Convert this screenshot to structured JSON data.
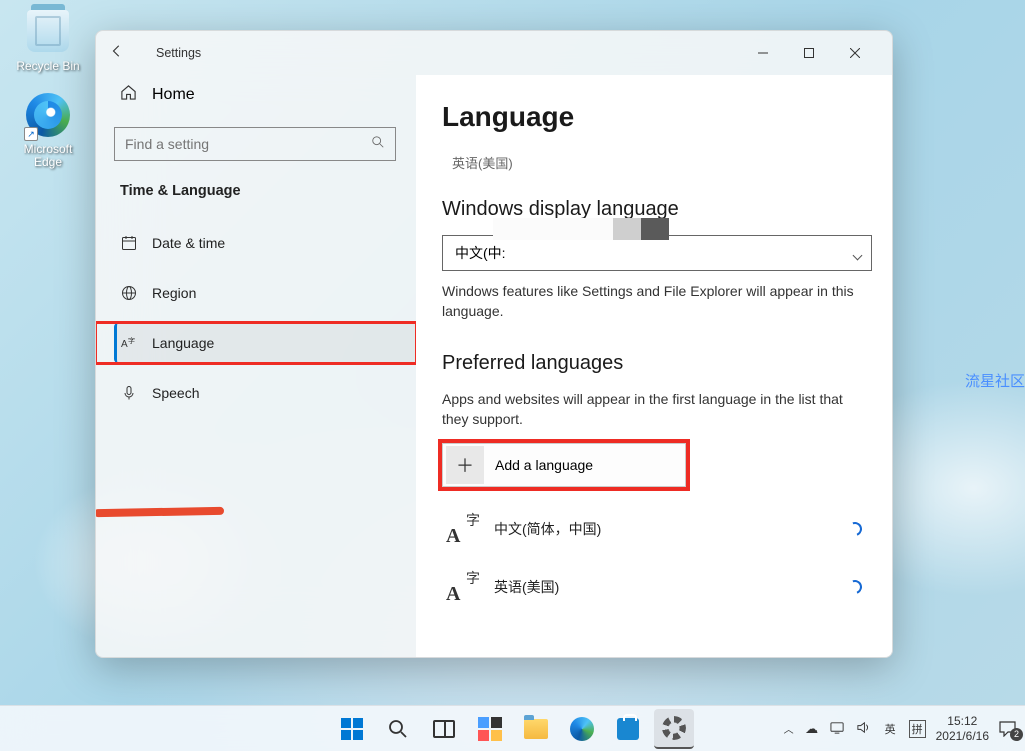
{
  "desktop": {
    "icons": [
      {
        "label": "Recycle Bin"
      },
      {
        "label": "Microsoft Edge"
      }
    ],
    "watermark": "流星社区"
  },
  "window": {
    "title": "Settings",
    "sidebar": {
      "home": "Home",
      "search_placeholder": "Find a setting",
      "section": "Time & Language",
      "items": [
        {
          "label": "Date & time"
        },
        {
          "label": "Region"
        },
        {
          "label": "Language"
        },
        {
          "label": "Speech"
        }
      ]
    },
    "content": {
      "title": "Language",
      "breadcrumb": "英语(美国)",
      "display_section": "Windows display language",
      "display_selected": "中文(中:",
      "display_desc": "Windows features like Settings and File Explorer will appear in this language.",
      "preferred_section": "Preferred languages",
      "preferred_desc": "Apps and websites will appear in the first language in the list that they support.",
      "add_label": "Add a language",
      "langs": [
        {
          "label": "中文(简体，中国)"
        },
        {
          "label": "英语(美国)"
        }
      ]
    }
  },
  "taskbar": {
    "systray": {
      "ime_lang": "英",
      "ime_mode": "拼",
      "time": "15:12",
      "date": "2021/6/16",
      "notif_count": "2"
    }
  }
}
